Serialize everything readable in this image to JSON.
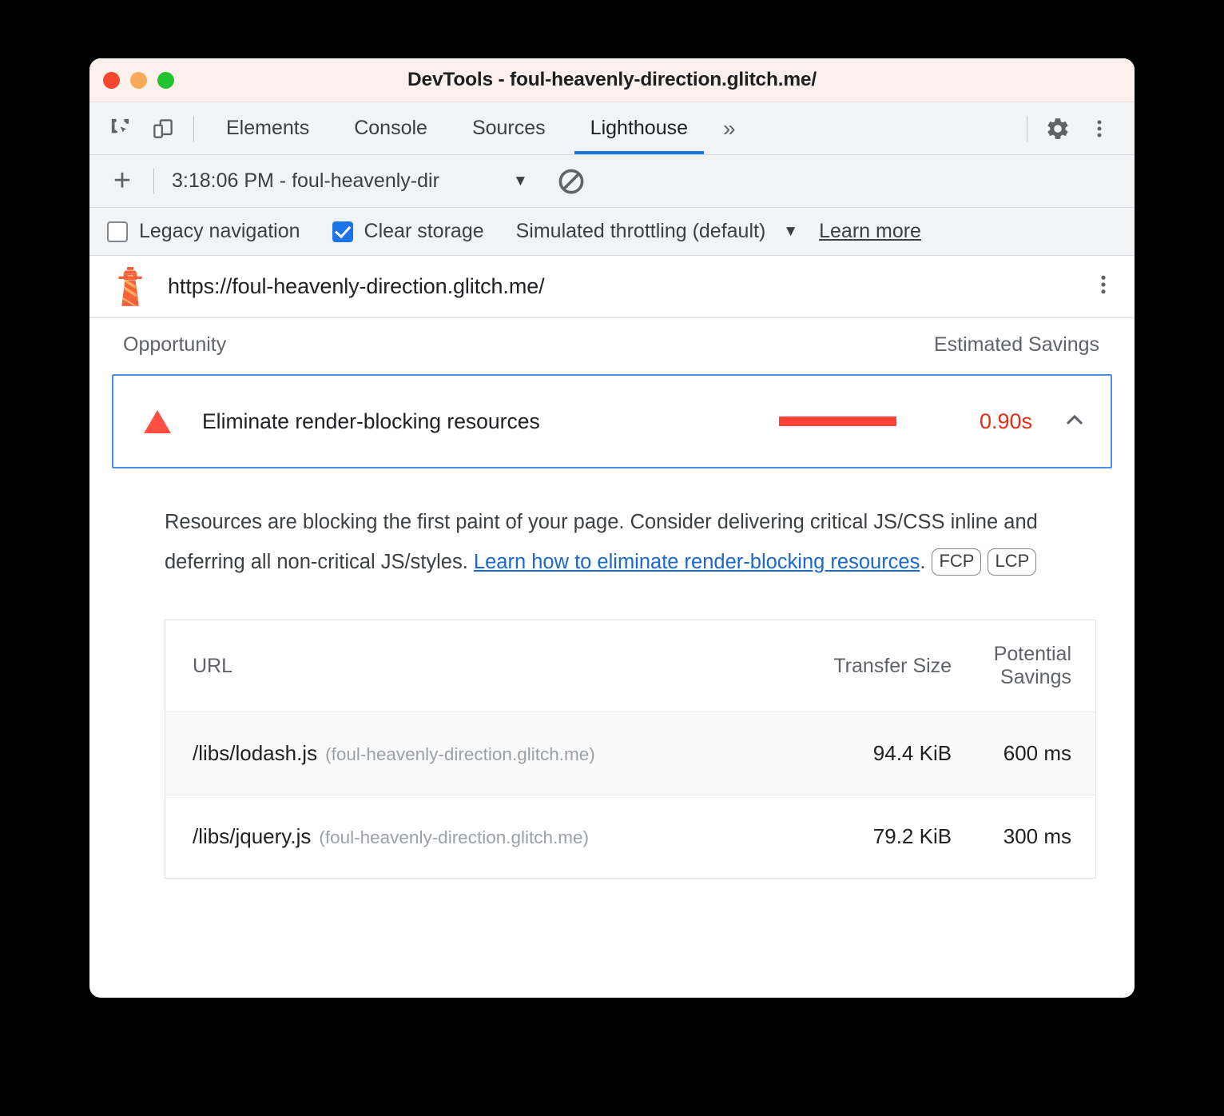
{
  "window": {
    "title": "DevTools - foul-heavenly-direction.glitch.me/",
    "traffic_lights": [
      "close",
      "minimize",
      "zoom"
    ]
  },
  "tabbar": {
    "inspect_icon": "inspect-element-icon",
    "device_icon": "device-toolbar-icon",
    "tabs": [
      {
        "label": "Elements",
        "active": false
      },
      {
        "label": "Console",
        "active": false
      },
      {
        "label": "Sources",
        "active": false
      },
      {
        "label": "Lighthouse",
        "active": true
      }
    ],
    "overflow_label": "»",
    "settings_icon": "gear-icon",
    "more_icon": "more-vertical-icon",
    "active_underline_color": "#1a73e8"
  },
  "lh_toolbar": {
    "new_report_label": "+",
    "report_label": "3:18:06 PM - foul-heavenly-dir",
    "caret": "▼",
    "clear_icon": "clear-no-entry-icon"
  },
  "settings": {
    "legacy_navigation": {
      "label": "Legacy navigation",
      "checked": false
    },
    "clear_storage": {
      "label": "Clear storage",
      "checked": true
    },
    "throttling": {
      "label": "Simulated throttling (default)",
      "caret": "▼"
    },
    "learn_more": "Learn more"
  },
  "url_row": {
    "logo": "lighthouse-icon",
    "url": "https://foul-heavenly-direction.glitch.me/",
    "menu_icon": "more-vertical-icon"
  },
  "report": {
    "col_opportunity": "Opportunity",
    "col_estimated_savings": "Estimated Savings",
    "opportunity": {
      "severity_icon": "warning-triangle-icon",
      "severity_color": "#ff4e42",
      "title": "Eliminate render-blocking resources",
      "savings_value": "0.90s",
      "savings_color": "#e82b16",
      "bar_color": "#ff4136",
      "bar_fraction": 0.9,
      "expanded": true,
      "collapse_icon": "chevron-up-icon"
    },
    "description": {
      "text_before": "Resources are blocking the first paint of your page. Consider delivering critical JS/CSS inline and deferring all non-critical JS/styles. ",
      "link_text": "Learn how to eliminate render-blocking resources",
      "text_after": ".",
      "badges": [
        "FCP",
        "LCP"
      ]
    },
    "table": {
      "columns": [
        {
          "key": "url",
          "label": "URL",
          "align": "left"
        },
        {
          "key": "transfer_size",
          "label": "Transfer Size",
          "align": "right"
        },
        {
          "key": "potential_savings",
          "label": "Potential Savings",
          "align": "right"
        }
      ],
      "rows": [
        {
          "url_path": "/libs/lodash.js",
          "url_host": "(foul-heavenly-direction.glitch.me)",
          "transfer_size": "94.4 KiB",
          "potential_savings": "600 ms"
        },
        {
          "url_path": "/libs/jquery.js",
          "url_host": "(foul-heavenly-direction.glitch.me)",
          "transfer_size": "79.2 KiB",
          "potential_savings": "300 ms"
        }
      ]
    }
  }
}
